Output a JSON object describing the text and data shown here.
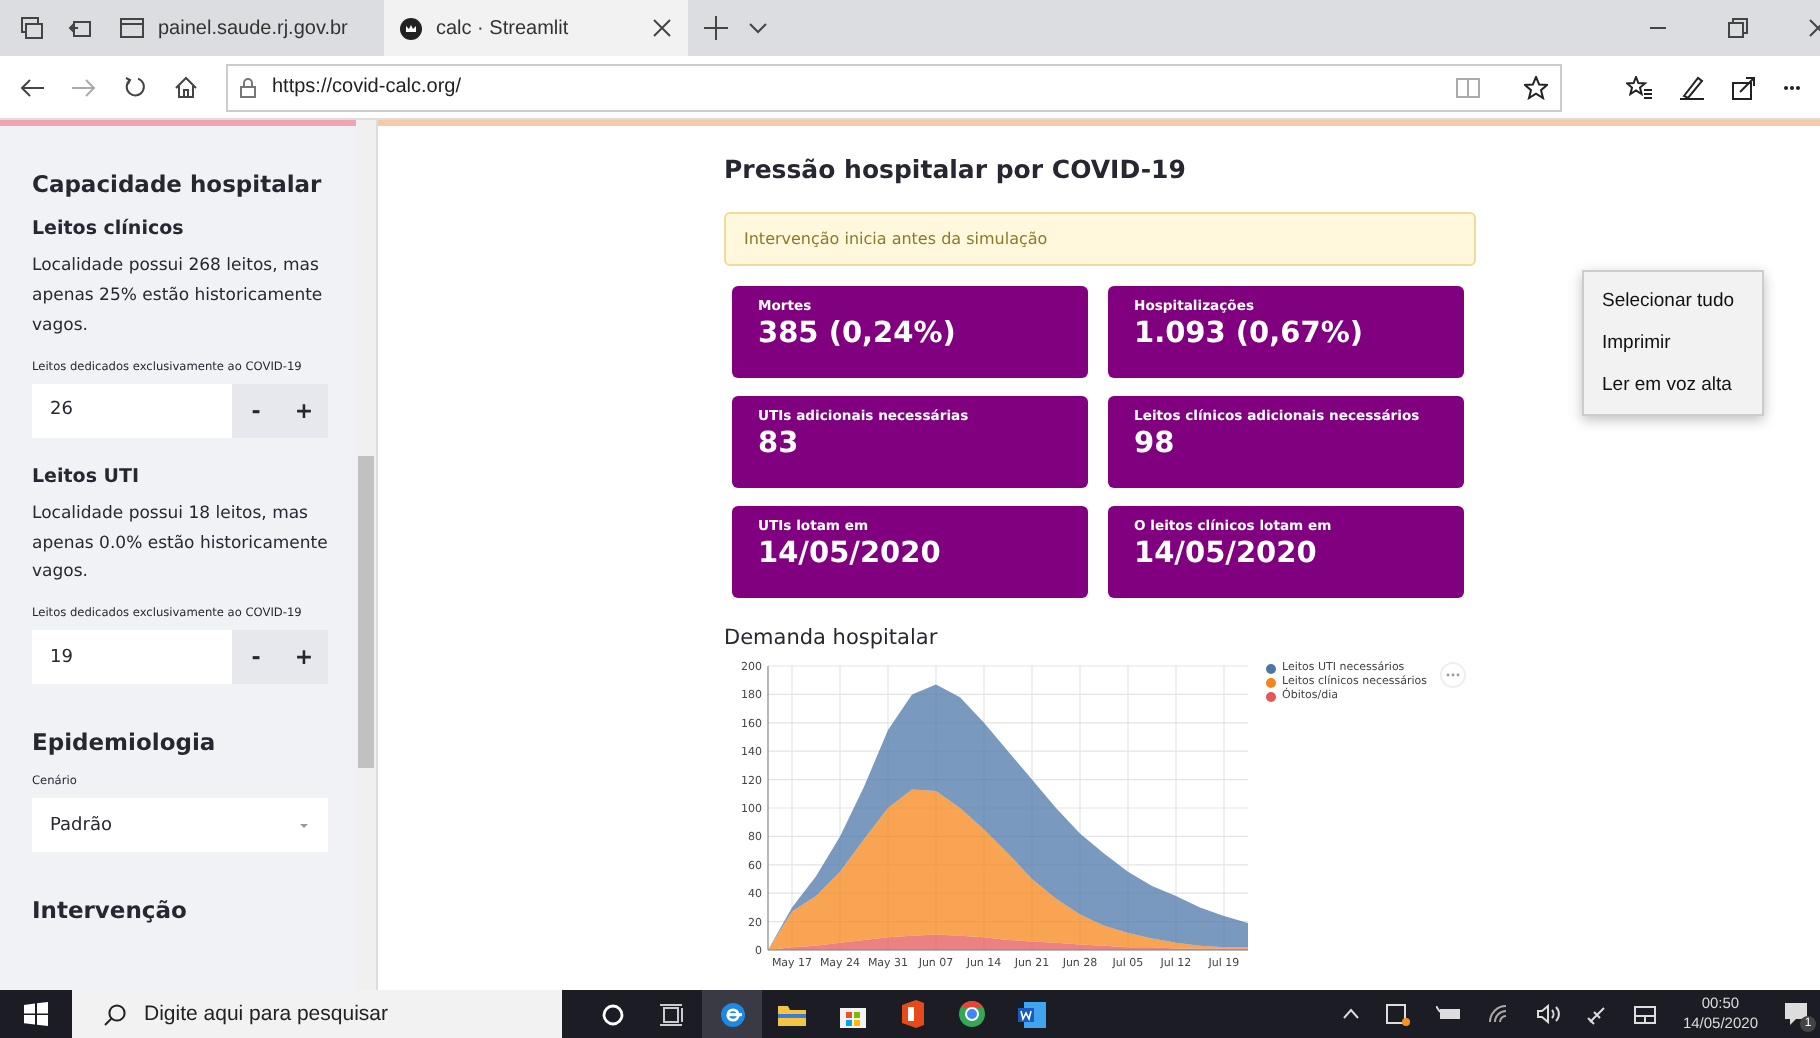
{
  "browser": {
    "tabs": [
      {
        "title": "painel.saude.rj.gov.br",
        "selected": false
      },
      {
        "title": "calc · Streamlit",
        "selected": true
      }
    ],
    "url": "https://covid-calc.org/"
  },
  "sidebar": {
    "items": [
      {
        "kind": "heading",
        "text": "Capacidade hospitalar"
      },
      {
        "kind": "subheading",
        "text": "Leitos clínicos"
      },
      {
        "kind": "paragraph",
        "text": "Localidade possui 268 leitos, mas apenas 25% estão historicamente vagos."
      },
      {
        "kind": "number_input",
        "label": "Leitos dedicados exclusivamente ao COVID-19",
        "value": "26",
        "minus": "-",
        "plus": "+"
      },
      {
        "kind": "subheading",
        "text": "Leitos UTI"
      },
      {
        "kind": "paragraph",
        "text": "Localidade possui 18 leitos, mas apenas 0.0% estão historicamente vagos."
      },
      {
        "kind": "number_input",
        "label": "Leitos dedicados exclusivamente ao COVID-19",
        "value": "19",
        "minus": "-",
        "plus": "+"
      },
      {
        "kind": "heading",
        "text": "Epidemiologia"
      },
      {
        "kind": "select",
        "label": "Cenário",
        "value": "Padrão"
      },
      {
        "kind": "heading",
        "text": "Intervenção"
      }
    ]
  },
  "main": {
    "title": "Pressão hospitalar por COVID-19",
    "alert": "Intervenção inicia antes da simulação",
    "metrics": [
      {
        "label": "Mortes",
        "value": "385 (0,24%)"
      },
      {
        "label": "Hospitalizações",
        "value": "1.093 (0,67%)"
      },
      {
        "label": "UTIs adicionais necessárias",
        "value": "83"
      },
      {
        "label": "Leitos clínicos adicionais necessários",
        "value": "98"
      },
      {
        "label": "UTIs lotam em",
        "value": "14/05/2020"
      },
      {
        "label": "O leitos clínicos lotam em",
        "value": "14/05/2020"
      }
    ],
    "chart_title": "Demanda hospitalar",
    "chart_data": {
      "type": "area",
      "stacked": true,
      "categories": [
        null,
        "May 17",
        null,
        "May 24",
        null,
        "May 31",
        null,
        "Jun 07",
        null,
        "Jun 14",
        null,
        "Jun 21",
        null,
        "Jun 28",
        null,
        "Jul 05",
        null,
        "Jul 12",
        null,
        "Jul 19",
        null
      ],
      "series": [
        {
          "name": "Leitos UTI necessários",
          "color": "#4c78a8",
          "values": [
            0,
            3,
            14,
            25,
            37,
            55,
            67,
            75,
            78,
            75,
            72,
            70,
            64,
            57,
            51,
            43,
            37,
            33,
            27,
            22,
            17
          ]
        },
        {
          "name": "Leitos clínicos necessários",
          "color": "#f58518",
          "values": [
            0,
            25,
            35,
            50,
            71,
            91,
            103,
            101,
            90,
            76,
            61,
            44,
            31,
            21,
            14,
            10,
            6,
            4,
            2,
            1,
            1
          ]
        },
        {
          "name": "Óbitos/dia",
          "color": "#e45756",
          "values": [
            0,
            2,
            3,
            5,
            7,
            9,
            10,
            11,
            10,
            9,
            7,
            6,
            5,
            4,
            3,
            2,
            2,
            1,
            1,
            1,
            1
          ]
        }
      ],
      "grid": true,
      "legend": "right",
      "ylim": [
        0,
        200
      ],
      "yticks": [
        0,
        20,
        40,
        60,
        80,
        100,
        120,
        140,
        160,
        180,
        200
      ]
    }
  },
  "context_menu": {
    "items": [
      "Selecionar tudo",
      "Imprimir",
      "Ler em voz alta"
    ]
  },
  "taskbar": {
    "search_placeholder": "Digite aqui para pesquisar",
    "time": "00:50",
    "date": "14/05/2020",
    "notification_count": "1"
  }
}
